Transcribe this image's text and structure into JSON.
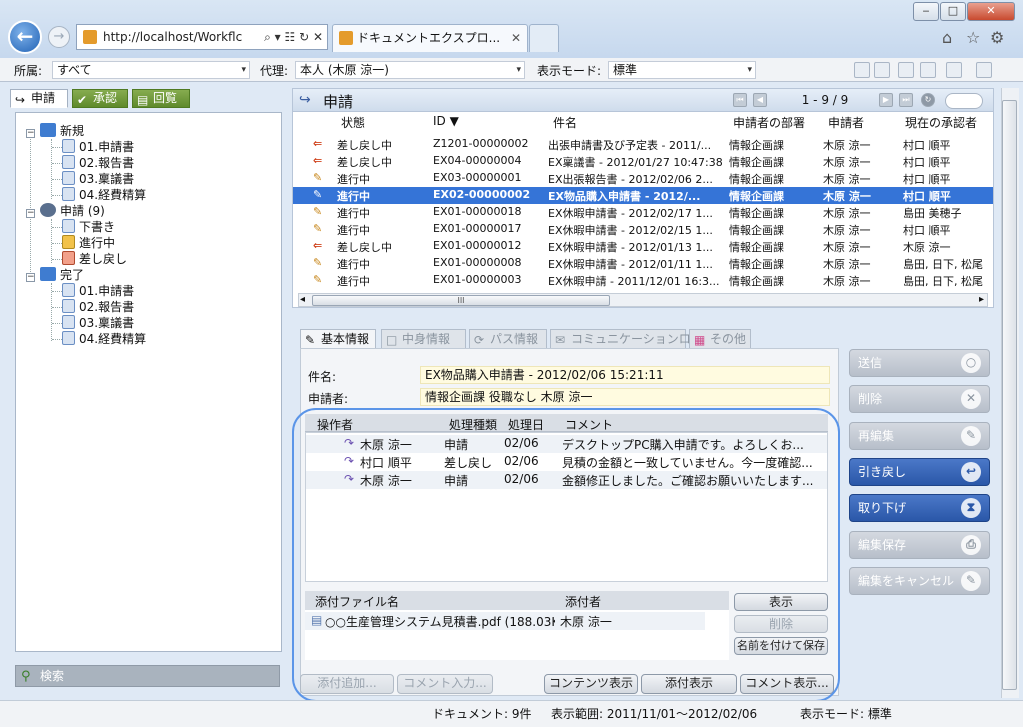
{
  "browser": {
    "address": "http://localhost/Workflc",
    "address_controls": "⌕ ▾ ☷ ↻ ✕",
    "tab_title": "ドキュメントエクスプロ...",
    "tab_close": "✕",
    "back_glyph": "←",
    "fwd_glyph": "→",
    "win_min": "‒",
    "win_max": "□",
    "win_close": "✕",
    "home_glyph": "⌂",
    "star_glyph": "☆",
    "gear_glyph": "⚙"
  },
  "toolbar": {
    "affiliation_label": "所属:",
    "affiliation_value": "すべて",
    "proxy_label": "代理:",
    "proxy_value": "本人 (木原 涼一)",
    "display_mode_label": "表示モード:",
    "display_mode_value": "標準",
    "dropdown_glyph": "▾"
  },
  "left_tabs": [
    {
      "label": "申請",
      "icon": "↪"
    },
    {
      "label": "承認",
      "icon": "✔"
    },
    {
      "label": "回覧",
      "icon": "▤"
    }
  ],
  "tree": {
    "new": {
      "label": "新規",
      "items": [
        "01.申請書",
        "02.報告書",
        "03.稟議書",
        "04.経費精算"
      ]
    },
    "applying": {
      "label": "申請 (9)",
      "items": [
        "下書き",
        "進行中",
        "差し戻し"
      ]
    },
    "done": {
      "label": "完了",
      "items": [
        "01.申請書",
        "02.報告書",
        "03.稟議書",
        "04.経費精算"
      ]
    },
    "expanded_glyph": "−"
  },
  "search_label": "検索",
  "list": {
    "title": "申請",
    "page_info": "1 - 9 / 9",
    "pager_glyphs": {
      "first": "⏮",
      "prev": "◀",
      "next": "▶",
      "last": "⏭",
      "refresh": "↻"
    },
    "columns": [
      "状態",
      "ID ▼",
      "件名",
      "申請者の部署",
      "申請者",
      "現在の承認者"
    ],
    "rows": [
      {
        "status": "差し戻し中",
        "id": "Z1201-00000002",
        "subject": "出張申請書及び予定表 - 2011/...",
        "dept": "情報企画課",
        "applicant": "木原 涼一",
        "approver": "村口 順平",
        "kind": "return"
      },
      {
        "status": "差し戻し中",
        "id": "EX04-00000004",
        "subject": "EX稟議書 - 2012/01/27 10:47:38",
        "dept": "情報企画課",
        "applicant": "木原 涼一",
        "approver": "村口 順平",
        "kind": "return"
      },
      {
        "status": "進行中",
        "id": "EX03-00000001",
        "subject": "EX出張報告書 - 2012/02/06 2...",
        "dept": "情報企画課",
        "applicant": "木原 涼一",
        "approver": "村口 順平",
        "kind": "progress"
      },
      {
        "status": "進行中",
        "id": "EX02-00000002",
        "subject": "EX物品購入申請書 - 2012/...",
        "dept": "情報企画課",
        "applicant": "木原 涼一",
        "approver": "村口 順平",
        "kind": "progress"
      },
      {
        "status": "進行中",
        "id": "EX01-00000018",
        "subject": "EX休暇申請書 - 2012/02/17 1...",
        "dept": "情報企画課",
        "applicant": "木原 涼一",
        "approver": "島田 美穂子",
        "kind": "progress"
      },
      {
        "status": "進行中",
        "id": "EX01-00000017",
        "subject": "EX休暇申請書 - 2012/02/15 1...",
        "dept": "情報企画課",
        "applicant": "木原 涼一",
        "approver": "村口 順平",
        "kind": "progress"
      },
      {
        "status": "差し戻し中",
        "id": "EX01-00000012",
        "subject": "EX休暇申請書 - 2012/01/13 1...",
        "dept": "情報企画課",
        "applicant": "木原 涼一",
        "approver": "木原 涼一",
        "kind": "return"
      },
      {
        "status": "進行中",
        "id": "EX01-00000008",
        "subject": "EX休暇申請書 - 2012/01/11 1...",
        "dept": "情報企画課",
        "applicant": "木原 涼一",
        "approver": "島田, 日下, 松尾",
        "kind": "progress"
      },
      {
        "status": "進行中",
        "id": "EX01-00000003",
        "subject": "EX休暇申請 - 2011/12/01 16:3...",
        "dept": "情報企画課",
        "applicant": "木原 涼一",
        "approver": "島田, 日下, 松尾",
        "kind": "progress"
      }
    ],
    "scroll_grip": "III",
    "scroll_left": "◂",
    "scroll_right": "▸"
  },
  "detail_tabs": [
    "基本情報",
    "中身情報",
    "パス情報",
    "コミュニケーションログ",
    "その他"
  ],
  "detail": {
    "subject_label": "件名:",
    "subject_value": "EX物品購入申請書 - 2012/02/06 15:21:11",
    "applicant_label": "申請者:",
    "applicant_value": "情報企画課 役職なし 木原 涼一",
    "log_columns": [
      "操作者",
      "処理種類",
      "処理日",
      "コメント"
    ],
    "log_rows": [
      {
        "operator": "木原 涼一",
        "type": "申請",
        "date": "02/06",
        "comment": "デスクトップPC購入申請です。よろしくお..."
      },
      {
        "operator": "村口 順平",
        "type": "差し戻し",
        "date": "02/06",
        "comment": "見積の金額と一致していません。今一度確認..."
      },
      {
        "operator": "木原 涼一",
        "type": "申請",
        "date": "02/06",
        "comment": "金額修正しました。ご確認お願いいたします..."
      }
    ],
    "attach_columns": [
      "添付ファイル名",
      "添付者"
    ],
    "attach_rows": [
      {
        "name": "○○生産管理システム見積書.pdf (188.03KB)",
        "by": "木原 涼一"
      }
    ],
    "attach_buttons": [
      "表示",
      "削除",
      "名前を付けて保存"
    ],
    "bottom_buttons": [
      "添付追加...",
      "コメント入力...",
      "コンテンツ表示",
      "添付表示",
      "コメント表示..."
    ]
  },
  "side_buttons": [
    {
      "label": "送信",
      "icon": "○",
      "enabled": false
    },
    {
      "label": "削除",
      "icon": "✕",
      "enabled": false
    },
    {
      "label": "再編集",
      "icon": "✎",
      "enabled": false
    },
    {
      "label": "引き戻し",
      "icon": "↩",
      "enabled": true
    },
    {
      "label": "取り下げ",
      "icon": "⧗",
      "enabled": true
    },
    {
      "label": "編集保存",
      "icon": "⎙",
      "enabled": false
    },
    {
      "label": "編集をキャンセル",
      "icon": "✎",
      "enabled": false
    }
  ],
  "status_bar": {
    "documents": "ドキュメント: 9件",
    "range": "表示範囲: 2011/11/01〜2012/02/06",
    "mode": "表示モード: 標準"
  },
  "colors": {
    "selected_row": "#3574d7",
    "active_button": "#2a57a8",
    "highlight": "#5b95e8"
  }
}
